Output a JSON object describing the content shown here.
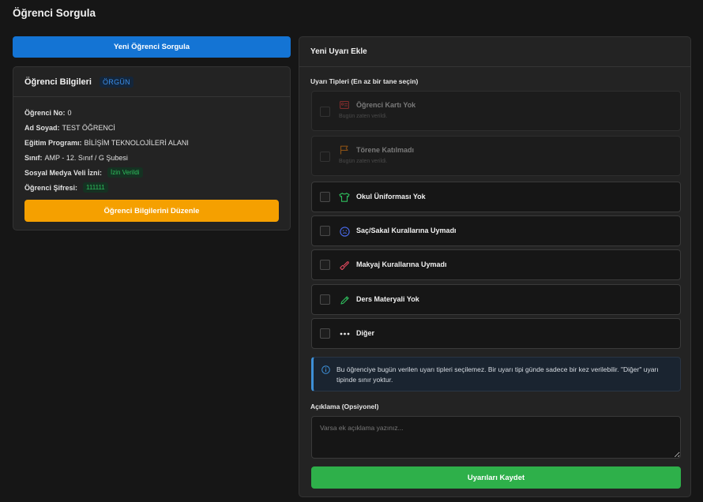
{
  "page": {
    "title": "Öğrenci Sorgula"
  },
  "left": {
    "new_query_label": "Yeni Öğrenci Sorgula",
    "card_title": "Öğrenci Bilgileri",
    "status_badge": "ÖRGÜN",
    "rows": [
      {
        "label": "Öğrenci No:",
        "value": "0"
      },
      {
        "label": "Ad Soyad:",
        "value": "TEST ÖĞRENCİ"
      },
      {
        "label": "Eğitim Programı:",
        "value": "BİLİŞİM TEKNOLOJİLERİ ALANI"
      },
      {
        "label": "Sınıf:",
        "value": "AMP - 12. Sınıf / G Şubesi"
      },
      {
        "label": "Sosyal Medya Veli İzni:",
        "badge": "İzin Verildi"
      },
      {
        "label": "Öğrenci Şifresi:",
        "badge": "111111"
      }
    ],
    "edit_label": "Öğrenci Bilgilerini Düzenle"
  },
  "right": {
    "card_title": "Yeni Uyarı Ekle",
    "types_label": "Uyarı Tipleri (En az bir tane seçin)",
    "options": [
      {
        "label": "Öğrenci Kartı Yok",
        "note": "Bugün zaten verildi.",
        "icon": "id-card-icon",
        "color": "#d23a3a",
        "disabled": true
      },
      {
        "label": "Törene Katılmadı",
        "note": "Bugün zaten verildi.",
        "icon": "flag-icon",
        "color": "#e07a10",
        "disabled": true
      },
      {
        "label": "Okul Üniforması Yok",
        "icon": "shirt-icon",
        "color": "#2fbf5d",
        "disabled": false
      },
      {
        "label": "Saç/Sakal Kurallarına Uymadı",
        "icon": "face-icon",
        "color": "#4a6cf0",
        "disabled": false
      },
      {
        "label": "Makyaj Kurallarına Uymadı",
        "icon": "makeup-icon",
        "color": "#e0485e",
        "disabled": false
      },
      {
        "label": "Ders Materyali Yok",
        "icon": "pencil-icon",
        "color": "#2fbf5d",
        "disabled": false
      },
      {
        "label": "Diğer",
        "icon": "dots-icon",
        "color": "#e6e6e6",
        "disabled": false
      }
    ],
    "alert_text": "Bu öğrenciye bugün verilen uyarı tipleri seçilemez. Bir uyarı tipi günde sadece bir kez verilebilir. \"Diğer\" uyarı tipinde sınır yoktur.",
    "desc_label": "Açıklama (Opsiyonel)",
    "desc_placeholder": "Varsa ek açıklama yazınız...",
    "save_label": "Uyarıları Kaydet"
  }
}
